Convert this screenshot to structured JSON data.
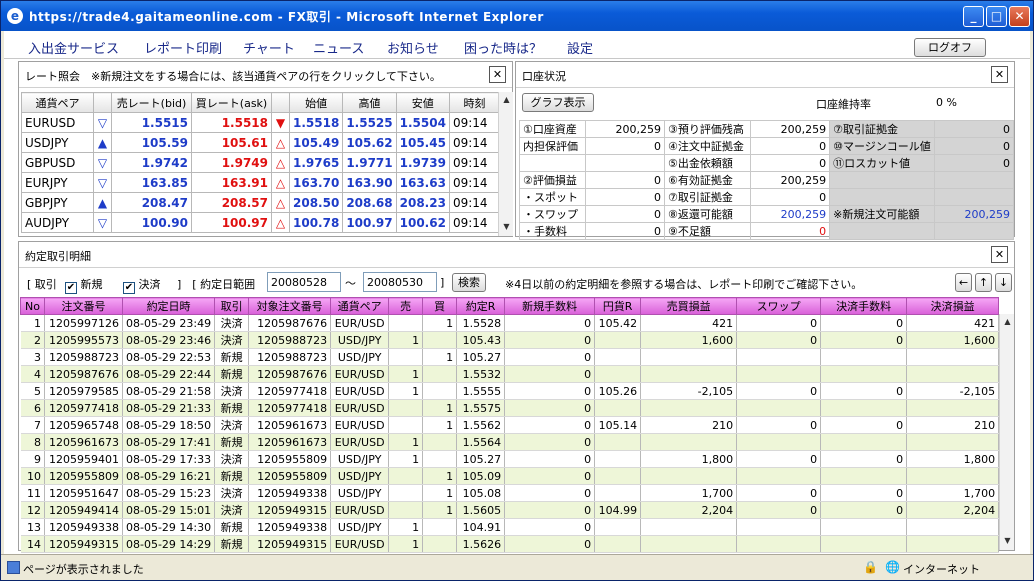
{
  "window": {
    "title": "https://trade4.gaitameonline.com - FX取引 - Microsoft Internet Explorer"
  },
  "menu": [
    "入出金サービス",
    "レポート印刷",
    "チャート",
    "ニュース",
    "お知らせ",
    "困った時は？",
    "設定"
  ],
  "logoff": "ログオフ",
  "rate_panel": {
    "title": "レート照会　※新規注文をする場合には、該当通貨ペアの行をクリックして下さい。",
    "headers": [
      "通貨ペア",
      "",
      "売レート(bid)",
      "買レート(ask)",
      "",
      "始値",
      "高値",
      "安値",
      "時刻"
    ],
    "rows": [
      {
        "pair": "EURUSD",
        "up": false,
        "bid": "1.5515",
        "ask": "1.5518",
        "askup": false,
        "open": "1.5518",
        "high": "1.5525",
        "low": "1.5504",
        "time": "09:14"
      },
      {
        "pair": "USDJPY",
        "up": true,
        "bid": "105.59",
        "ask": "105.61",
        "askup": true,
        "open": "105.49",
        "high": "105.62",
        "low": "105.45",
        "time": "09:14"
      },
      {
        "pair": "GBPUSD",
        "up": false,
        "bid": "1.9742",
        "ask": "1.9749",
        "askup": true,
        "open": "1.9765",
        "high": "1.9771",
        "low": "1.9739",
        "time": "09:14"
      },
      {
        "pair": "EURJPY",
        "up": false,
        "bid": "163.85",
        "ask": "163.91",
        "askup": true,
        "open": "163.70",
        "high": "163.90",
        "low": "163.63",
        "time": "09:14"
      },
      {
        "pair": "GBPJPY",
        "up": true,
        "bid": "208.47",
        "ask": "208.57",
        "askup": true,
        "open": "208.50",
        "high": "208.68",
        "low": "208.23",
        "time": "09:14"
      },
      {
        "pair": "AUDJPY",
        "up": false,
        "bid": "100.90",
        "ask": "100.97",
        "askup": true,
        "open": "100.78",
        "high": "100.97",
        "low": "100.62",
        "time": "09:14"
      }
    ]
  },
  "account_panel": {
    "title": "口座状況",
    "graph_button": "グラフ表示",
    "maintain_label": "口座維持率",
    "maintain_value": "0 %",
    "rows": [
      [
        "①口座資産",
        "200,259",
        "③預り評価残高",
        "200,259",
        "⑦取引証拠金",
        "0"
      ],
      [
        "内担保評価",
        "0",
        "④注文中証拠金",
        "0",
        "⑩マージンコール値",
        "0"
      ],
      [
        "",
        "",
        "⑤出金依頼額",
        "0",
        "⑪ロスカット値",
        "0"
      ],
      [
        "②評価損益",
        "0",
        "⑥有効証拠金",
        "200,259",
        "",
        ""
      ],
      [
        "・スポット",
        "0",
        "⑦取引証拠金",
        "0",
        "",
        ""
      ],
      [
        "・スワップ",
        "0",
        "⑧返還可能額",
        "200,259",
        "※新規注文可能額",
        "200,259"
      ],
      [
        "・手数料",
        "0",
        "⑨不足額",
        "0",
        "",
        ""
      ]
    ]
  },
  "contract_panel": {
    "title": "約定取引明細",
    "filter": {
      "label1": "[ 取引",
      "new": "新規",
      "settle": "決済",
      "label2": "]　[ 約定日範囲",
      "from": "20080528",
      "tilde": "〜",
      "to": "20080530",
      "end": "]",
      "search": "検索",
      "note": "※4日以前の約定明細を参照する場合は、レポート印刷でご確認下さい。"
    },
    "nav": [
      "←",
      "↑",
      "↓"
    ],
    "headers": [
      "No",
      "注文番号",
      "約定日時",
      "取引",
      "対象注文番号",
      "通貨ペア",
      "売",
      "買",
      "約定R",
      "新規手数料",
      "円貨R",
      "売買損益",
      "スワップ",
      "決済手数料",
      "決済損益"
    ],
    "rows": [
      [
        "1",
        "1205997126",
        "08-05-29 23:49",
        "決済",
        "1205987676",
        "EUR/USD",
        "",
        "1",
        "1.5528",
        "0",
        "105.42",
        "421",
        "0",
        "0",
        "421"
      ],
      [
        "2",
        "1205995573",
        "08-05-29 23:46",
        "決済",
        "1205988723",
        "USD/JPY",
        "1",
        "",
        "105.43",
        "0",
        "",
        "1,600",
        "0",
        "0",
        "1,600"
      ],
      [
        "3",
        "1205988723",
        "08-05-29 22:53",
        "新規",
        "1205988723",
        "USD/JPY",
        "",
        "1",
        "105.27",
        "0",
        "",
        "",
        "",
        "",
        ""
      ],
      [
        "4",
        "1205987676",
        "08-05-29 22:44",
        "新規",
        "1205987676",
        "EUR/USD",
        "1",
        "",
        "1.5532",
        "0",
        "",
        "",
        "",
        "",
        ""
      ],
      [
        "5",
        "1205979585",
        "08-05-29 21:58",
        "決済",
        "1205977418",
        "EUR/USD",
        "1",
        "",
        "1.5555",
        "0",
        "105.26",
        "-2,105",
        "0",
        "0",
        "-2,105"
      ],
      [
        "6",
        "1205977418",
        "08-05-29 21:33",
        "新規",
        "1205977418",
        "EUR/USD",
        "",
        "1",
        "1.5575",
        "0",
        "",
        "",
        "",
        "",
        ""
      ],
      [
        "7",
        "1205965748",
        "08-05-29 18:50",
        "決済",
        "1205961673",
        "EUR/USD",
        "",
        "1",
        "1.5562",
        "0",
        "105.14",
        "210",
        "0",
        "0",
        "210"
      ],
      [
        "8",
        "1205961673",
        "08-05-29 17:41",
        "新規",
        "1205961673",
        "EUR/USD",
        "1",
        "",
        "1.5564",
        "0",
        "",
        "",
        "",
        "",
        ""
      ],
      [
        "9",
        "1205959401",
        "08-05-29 17:33",
        "決済",
        "1205955809",
        "USD/JPY",
        "1",
        "",
        "105.27",
        "0",
        "",
        "1,800",
        "0",
        "0",
        "1,800"
      ],
      [
        "10",
        "1205955809",
        "08-05-29 16:21",
        "新規",
        "1205955809",
        "USD/JPY",
        "",
        "1",
        "105.09",
        "0",
        "",
        "",
        "",
        "",
        ""
      ],
      [
        "11",
        "1205951647",
        "08-05-29 15:23",
        "決済",
        "1205949338",
        "USD/JPY",
        "",
        "1",
        "105.08",
        "0",
        "",
        "1,700",
        "0",
        "0",
        "1,700"
      ],
      [
        "12",
        "1205949414",
        "08-05-29 15:01",
        "決済",
        "1205949315",
        "EUR/USD",
        "",
        "1",
        "1.5605",
        "0",
        "104.99",
        "2,204",
        "0",
        "0",
        "2,204"
      ],
      [
        "13",
        "1205949338",
        "08-05-29 14:30",
        "新規",
        "1205949338",
        "USD/JPY",
        "1",
        "",
        "104.91",
        "0",
        "",
        "",
        "",
        "",
        ""
      ],
      [
        "14",
        "1205949315",
        "08-05-29 14:29",
        "新規",
        "1205949315",
        "EUR/USD",
        "1",
        "",
        "1.5626",
        "0",
        "",
        "",
        "",
        "",
        ""
      ]
    ]
  },
  "status": {
    "text": "ページが表示されました",
    "zone": "インターネット"
  }
}
